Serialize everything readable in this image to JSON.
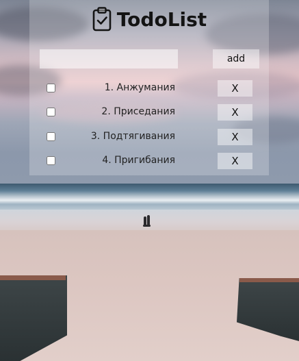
{
  "app": {
    "title": "TodoList",
    "title_icon": "clipboard-check-icon"
  },
  "new_todo": {
    "value": "",
    "placeholder": "",
    "add_label": "add"
  },
  "todos": [
    {
      "label": "1. Анжумания",
      "checked": false,
      "delete_label": "X"
    },
    {
      "label": "2. Приседания",
      "checked": false,
      "delete_label": "X"
    },
    {
      "label": "3. Подтягивания",
      "checked": false,
      "delete_label": "X"
    },
    {
      "label": "4. Пригибания",
      "checked": false,
      "delete_label": "X"
    }
  ],
  "background": {
    "image": "beach-sunset-photo"
  }
}
